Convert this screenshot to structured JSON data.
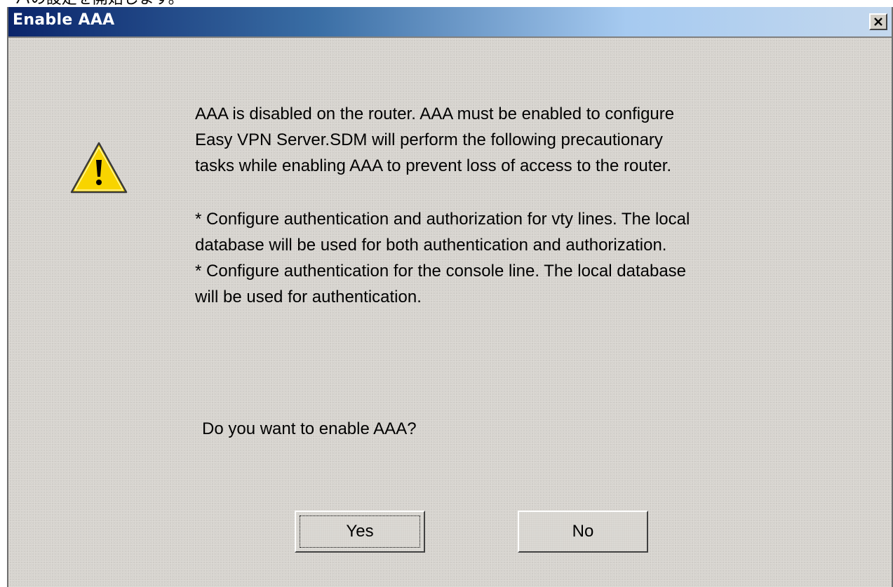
{
  "page_caption": "ーバの設定を開始します。",
  "dialog": {
    "title": "Enable AAA",
    "close_label": "×",
    "icon": "warning-icon",
    "message_lines": [
      "AAA is disabled on the router. AAA must be enabled to configure",
      "Easy VPN Server.SDM will perform the following precautionary",
      "tasks while enabling AAA to prevent loss of access to the router."
    ],
    "detail_lines": [
      "* Configure authentication and authorization for vty lines. The local",
      "database will be used for both authentication and authorization.",
      "* Configure authentication for the console line. The local database",
      "will be used for authentication."
    ],
    "question": "Do you want to enable AAA?",
    "yes_label": "Yes",
    "no_label": "No"
  },
  "colors": {
    "titlebar_start": "#0a246a",
    "titlebar_end": "#c4d8ee",
    "dialog_bg": "#d6d3ce",
    "warning_fill": "#f8d400"
  }
}
